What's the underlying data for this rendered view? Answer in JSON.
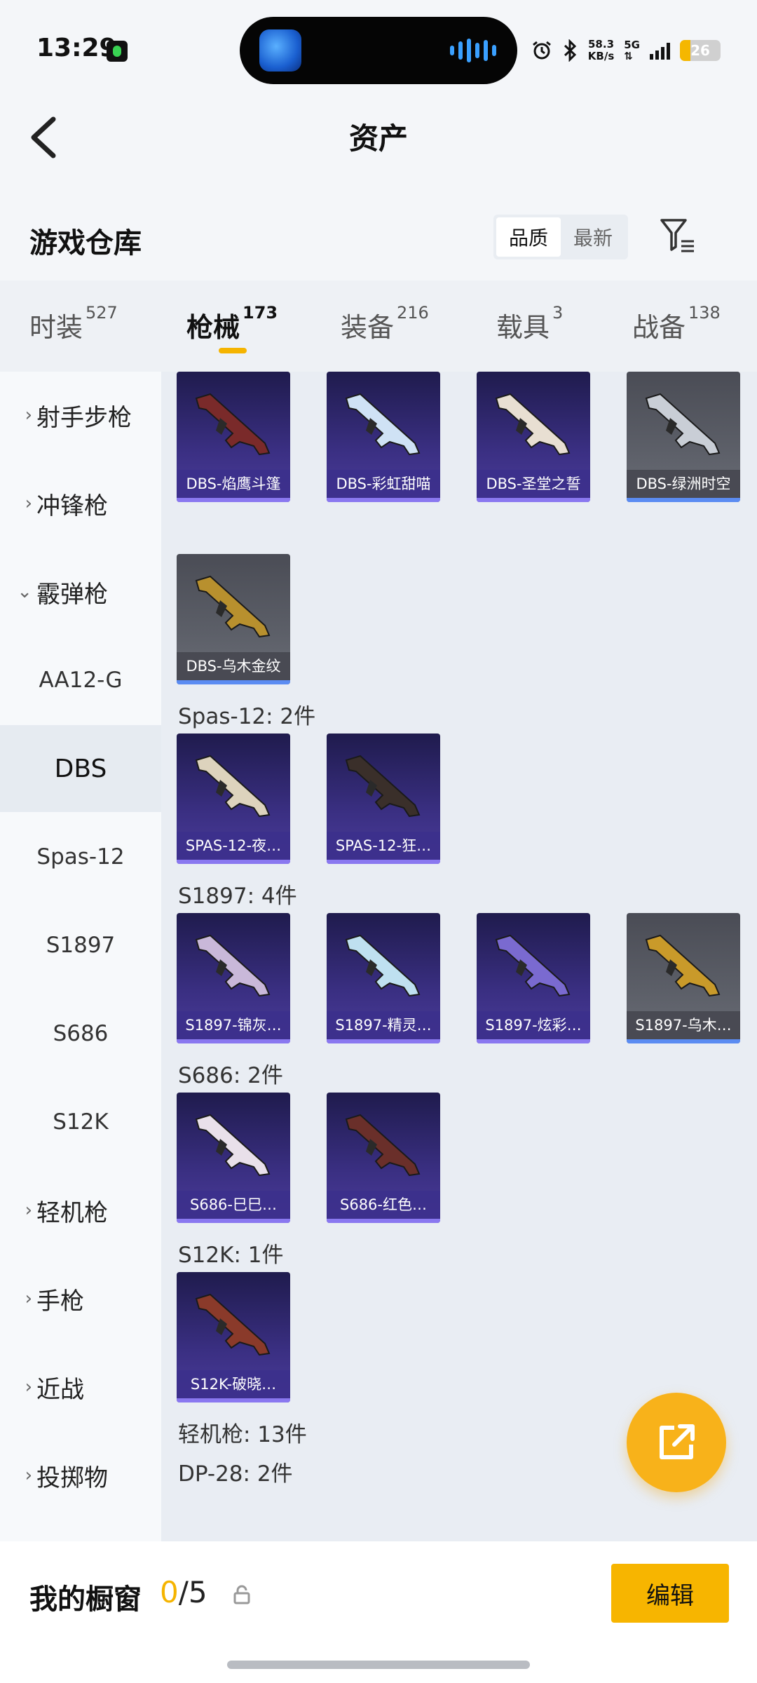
{
  "status_bar": {
    "time": "13:29",
    "speed_top": "58.3",
    "speed_unit": "KB/s",
    "network": "5G",
    "battery": "26",
    "battery_level": 0.26
  },
  "header": {
    "title": "资产"
  },
  "warehouse": {
    "title": "游戏仓库",
    "sort_options": [
      "品质",
      "最新"
    ],
    "sort_selected": "品质"
  },
  "tabs": [
    {
      "label": "时装",
      "count": "527"
    },
    {
      "label": "枪械",
      "count": "173",
      "active": true
    },
    {
      "label": "装备",
      "count": "216"
    },
    {
      "label": "载具",
      "count": "3"
    },
    {
      "label": "战备",
      "count": "138"
    }
  ],
  "side_menu": [
    {
      "label": "射手步枪",
      "type": "category",
      "expanded": false
    },
    {
      "label": "冲锋枪",
      "type": "category",
      "expanded": false
    },
    {
      "label": "霰弹枪",
      "type": "category",
      "expanded": true
    },
    {
      "label": "AA12-G",
      "type": "sub"
    },
    {
      "label": "DBS",
      "type": "sub",
      "selected": true
    },
    {
      "label": "Spas-12",
      "type": "sub"
    },
    {
      "label": "S1897",
      "type": "sub"
    },
    {
      "label": "S686",
      "type": "sub"
    },
    {
      "label": "S12K",
      "type": "sub"
    },
    {
      "label": "轻机枪",
      "type": "category",
      "expanded": false
    },
    {
      "label": "手枪",
      "type": "category",
      "expanded": false
    },
    {
      "label": "近战",
      "type": "category",
      "expanded": false
    },
    {
      "label": "投掷物",
      "type": "category",
      "expanded": false
    }
  ],
  "groups": [
    {
      "title": "",
      "items": [
        {
          "name": "DBS-焰鹰斗篷",
          "rarity": "purple",
          "gun_color": "#7a2a2a"
        },
        {
          "name": "DBS-彩虹甜喵",
          "rarity": "purple",
          "gun_color": "#cfe2f5"
        },
        {
          "name": "DBS-圣堂之誓",
          "rarity": "purple",
          "gun_color": "#e8dfd2"
        },
        {
          "name": "DBS-绿洲时空",
          "rarity": "gray",
          "gun_color": "#c9ced6"
        },
        {
          "name": "DBS-乌木金纹",
          "rarity": "gray",
          "gun_color": "#b8902e"
        }
      ]
    },
    {
      "title": "Spas-12: 2件",
      "items": [
        {
          "name": "SPAS-12-夜…",
          "rarity": "purple",
          "gun_color": "#ddd3bd"
        },
        {
          "name": "SPAS-12-狂…",
          "rarity": "purple",
          "gun_color": "#3a2f2a"
        }
      ]
    },
    {
      "title": "S1897: 4件",
      "items": [
        {
          "name": "S1897-锦灰…",
          "rarity": "purple",
          "gun_color": "#c9b8d9"
        },
        {
          "name": "S1897-精灵…",
          "rarity": "purple",
          "gun_color": "#bfe0f0"
        },
        {
          "name": "S1897-炫彩…",
          "rarity": "purple",
          "gun_color": "#7a6ad0"
        },
        {
          "name": "S1897-乌木…",
          "rarity": "gray",
          "gun_color": "#c99a2a"
        }
      ]
    },
    {
      "title": "S686: 2件",
      "items": [
        {
          "name": "S686-巳巳…",
          "rarity": "purple",
          "gun_color": "#e9e0ea"
        },
        {
          "name": "S686-红色…",
          "rarity": "purple",
          "gun_color": "#6a2f2a"
        }
      ]
    },
    {
      "title": "S12K: 1件",
      "items": [
        {
          "name": "S12K-破晓…",
          "rarity": "purple",
          "gun_color": "#8a3a2a"
        }
      ]
    },
    {
      "title": "轻机枪: 13件",
      "items": []
    },
    {
      "title": "DP-28: 2件",
      "items": []
    }
  ],
  "icons": {
    "back": "chevron-left-icon",
    "filter": "filter-icon",
    "share": "share-external-icon",
    "lock": "lock-icon"
  },
  "colors": {
    "accent": "#f7b500",
    "rarity_purple": "#3a2f82",
    "rarity_gray": "#5c5f68"
  },
  "bottom_bar": {
    "title": "我的橱窗",
    "count_current": "0",
    "count_total": "/5",
    "edit_label": "编辑"
  }
}
